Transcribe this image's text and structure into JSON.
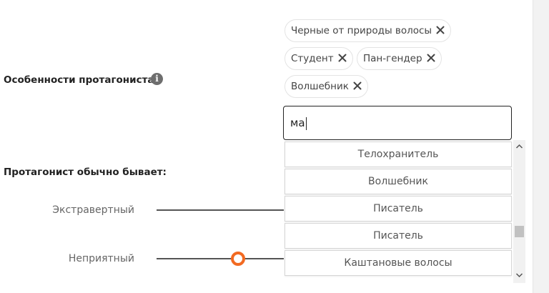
{
  "protagonist_features": {
    "label": "Особенности протагониста",
    "tags": [
      {
        "label": "Черные от природы волосы"
      },
      {
        "label": "Студент"
      },
      {
        "label": "Пан-гендер"
      },
      {
        "label": "Волшебник"
      }
    ],
    "search": {
      "value": "ма"
    },
    "dropdown_options": [
      {
        "label": "Телохранитель"
      },
      {
        "label": "Волшебник"
      },
      {
        "label": "Писатель"
      },
      {
        "label": "Писатель"
      },
      {
        "label": "Каштановые волосы"
      }
    ]
  },
  "protagonist_usually": {
    "label": "Протагонист обычно бывает:",
    "sliders": [
      {
        "label": "Экстравертный",
        "value": null
      },
      {
        "label": "Неприятный",
        "value": 0.64
      }
    ]
  },
  "colors": {
    "accent": "#f26a22"
  },
  "icons": {
    "info": "info-icon",
    "remove": "close-icon",
    "scroll_up": "chevron-up-icon",
    "scroll_down": "chevron-down-icon"
  }
}
